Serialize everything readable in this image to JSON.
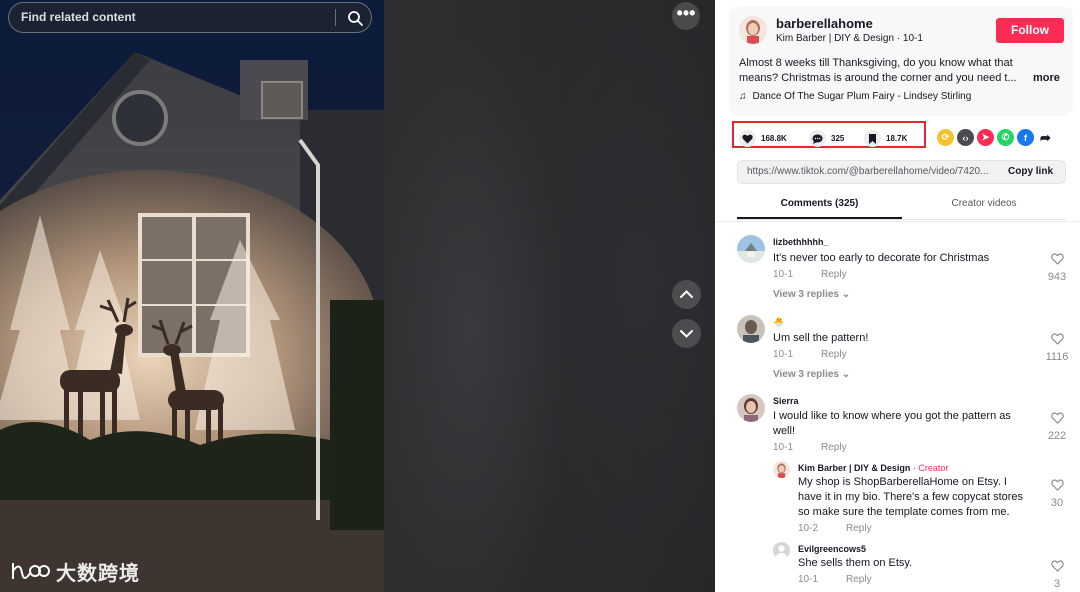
{
  "search": {
    "placeholder": "Find related content"
  },
  "video": {
    "more_label": "•••"
  },
  "watermark": {
    "text": "大数跨境"
  },
  "post": {
    "author": "barberellahome",
    "author_sub": "Kim Barber | DIY & Design · 10-1",
    "follow_label": "Follow",
    "desc_line1": "Almost 8 weeks till Thanksgiving, do you know what that",
    "desc_line2": "means? Christmas is around the corner and you need t...",
    "more_label": "more",
    "music": "Dance Of The Sugar Plum Fairy - Lindsey Stirling"
  },
  "stats": {
    "likes": "168.8K",
    "comments": "325",
    "saves": "18.7K"
  },
  "link": {
    "url": "https://www.tiktok.com/@barberellahome/video/7420...",
    "copy_label": "Copy link"
  },
  "tabs": {
    "comments": "Comments (325)",
    "creator": "Creator videos"
  },
  "comments": [
    {
      "user": "lizbethhhhh_",
      "text": "It's never too early to decorate for Christmas",
      "date": "10-1",
      "reply": "Reply",
      "likes": "943",
      "replies": "View 3 replies"
    },
    {
      "user": "🐣",
      "text": "Um sell the pattern!",
      "date": "10-1",
      "reply": "Reply",
      "likes": "1116",
      "replies": "View 3 replies"
    },
    {
      "user": "Sierra",
      "text_line1": "I would like to know where you got the pattern as",
      "text_line2": "well!",
      "date": "10-1",
      "reply": "Reply",
      "likes": "222"
    }
  ],
  "replies": [
    {
      "user": "Kim Barber | DIY & Design",
      "tag": " · Creator",
      "line1": "My shop is ShopBarberellaHome on Etsy. I",
      "line2": "have it in my bio. There's a few copycat stores",
      "line3": "so make sure the template comes from me.",
      "date": "10-2",
      "reply": "Reply",
      "likes": "30"
    },
    {
      "user": "Evilgreencows5",
      "text": "She sells them on Etsy.",
      "date": "10-1",
      "reply": "Reply",
      "likes": "3"
    }
  ],
  "colors": {
    "accent": "#fe2c55",
    "highlight_box": "#e8262b",
    "text": "#161823",
    "muted": "#8a8b91"
  },
  "icons": [
    "search-icon",
    "more-icon",
    "chevron-up-icon",
    "chevron-down-icon",
    "heart-icon",
    "comment-icon",
    "bookmark-icon",
    "music-icon",
    "share-icons"
  ]
}
